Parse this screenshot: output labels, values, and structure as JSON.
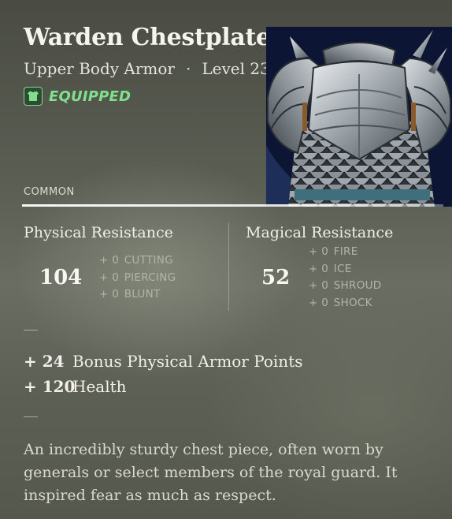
{
  "item": {
    "name": "Warden Chestplate",
    "type": "Upper Body Armor",
    "separator": "·",
    "level": "Level 23",
    "status": "EQUIPPED",
    "rarity": "COMMON",
    "equipped_color": "#7fe08d",
    "icons": {
      "equipped": "chestplate-icon",
      "artwork": "chestplate-artwork"
    }
  },
  "physical": {
    "heading": "Physical Resistance",
    "value": "104",
    "items": [
      {
        "amount": "+ 0",
        "label": "CUTTING"
      },
      {
        "amount": "+ 0",
        "label": "PIERCING"
      },
      {
        "amount": "+ 0",
        "label": "BLUNT"
      }
    ]
  },
  "magical": {
    "heading": "Magical Resistance",
    "value": "52",
    "items": [
      {
        "amount": "+ 0",
        "label": "FIRE"
      },
      {
        "amount": "+ 0",
        "label": "ICE"
      },
      {
        "amount": "+ 0",
        "label": "SHROUD"
      },
      {
        "amount": "+ 0",
        "label": "SHOCK"
      }
    ]
  },
  "bonuses": [
    {
      "amount": "+ 24",
      "label": "Bonus Physical Armor Points"
    },
    {
      "amount": "+ 120",
      "label": "Health"
    }
  ],
  "description": "An incredibly sturdy chest piece, often worn by generals or select members of the royal guard. It inspired fear as much as respect."
}
